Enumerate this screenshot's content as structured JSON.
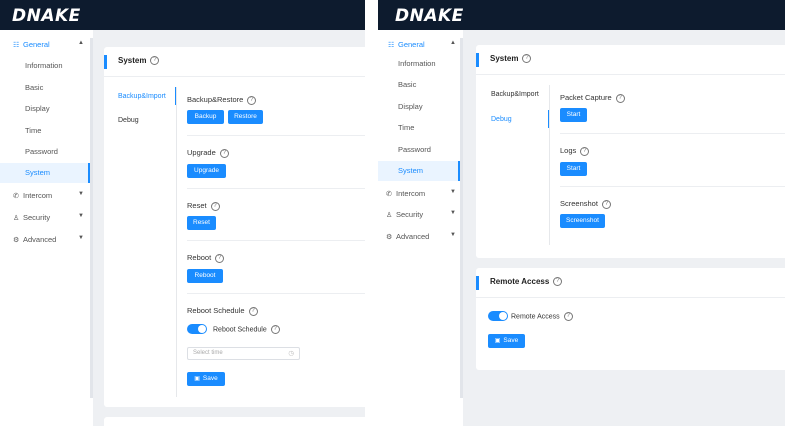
{
  "brand": {
    "logo": "DNAKE"
  },
  "sidebar": {
    "general_label": "General",
    "items": [
      "Information",
      "Basic",
      "Display",
      "Time",
      "Password",
      "System"
    ],
    "active": "System",
    "groups": [
      "Intercom",
      "Security",
      "Advanced"
    ]
  },
  "left_panel": {
    "card_title": "System",
    "tabs": [
      "Backup&Import",
      "Debug"
    ],
    "active_tab": "Backup&Import",
    "backup": {
      "title": "Backup&Restore",
      "buttons": [
        "Backup",
        "Restore"
      ]
    },
    "upgrade": {
      "title": "Upgrade",
      "button": "Upgrade"
    },
    "reset": {
      "title": "Reset",
      "button": "Reset"
    },
    "reboot": {
      "title": "Reboot",
      "button": "Reboot"
    },
    "schedule": {
      "title": "Reboot Schedule",
      "toggle_label": "Reboot Schedule",
      "toggle_on": true,
      "time_placeholder": "Select time",
      "save_button": "Save"
    }
  },
  "right_panel": {
    "card_title": "System",
    "tabs": [
      "Backup&Import",
      "Debug"
    ],
    "active_tab": "Debug",
    "packet": {
      "title": "Packet Capture",
      "button": "Start"
    },
    "logs": {
      "title": "Logs",
      "button": "Start"
    },
    "screenshot": {
      "title": "Screenshot",
      "button": "Screenshot"
    },
    "remote": {
      "card_title": "Remote Access",
      "toggle_label": "Remote Access",
      "toggle_on": true,
      "save_button": "Save"
    }
  },
  "colors": {
    "accent": "#1a8cff",
    "header": "#0d1b2e",
    "background": "#eef0f3"
  },
  "icons": [
    "grid-icon",
    "chevron-up-icon",
    "chevron-down-icon",
    "phone-icon",
    "user-shield-icon",
    "gear-icon",
    "question-circle-icon",
    "clock-icon",
    "save-icon"
  ]
}
